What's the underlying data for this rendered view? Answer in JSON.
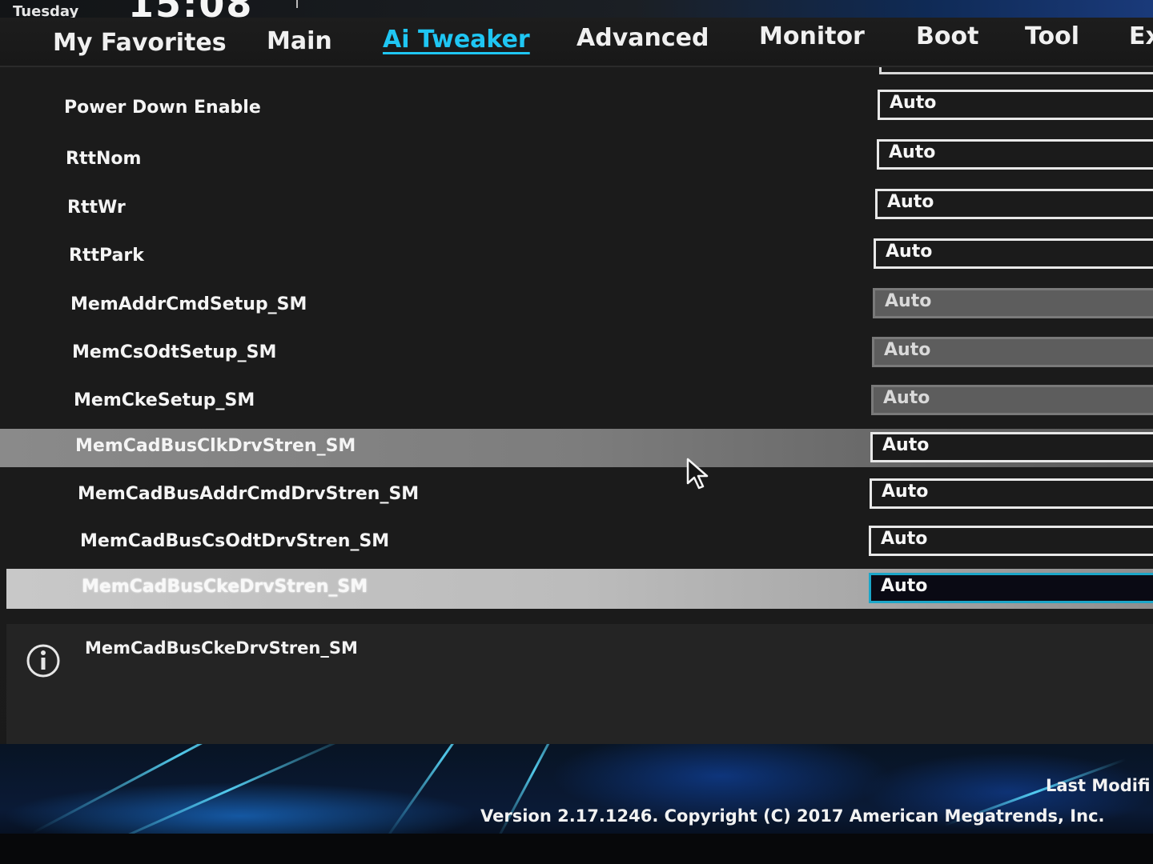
{
  "header": {
    "day": "Tuesday",
    "time": "15:08"
  },
  "nav": {
    "tabs": [
      {
        "label": "My Favorites",
        "active": false
      },
      {
        "label": "Main",
        "active": false
      },
      {
        "label": "Ai Tweaker",
        "active": true
      },
      {
        "label": "Advanced",
        "active": false
      },
      {
        "label": "Monitor",
        "active": false
      },
      {
        "label": "Boot",
        "active": false
      },
      {
        "label": "Tool",
        "active": false
      },
      {
        "label": "Ex",
        "active": false
      }
    ]
  },
  "settings": [
    {
      "label": "Power Down Enable",
      "value": "Auto",
      "state": "normal"
    },
    {
      "label": "RttNom",
      "value": "Auto",
      "state": "normal"
    },
    {
      "label": "RttWr",
      "value": "Auto",
      "state": "normal"
    },
    {
      "label": "RttPark",
      "value": "Auto",
      "state": "normal"
    },
    {
      "label": "MemAddrCmdSetup_SM",
      "value": "Auto",
      "state": "disabled"
    },
    {
      "label": "MemCsOdtSetup_SM",
      "value": "Auto",
      "state": "disabled"
    },
    {
      "label": "MemCkeSetup_SM",
      "value": "Auto",
      "state": "disabled"
    },
    {
      "label": "MemCadBusClkDrvStren_SM",
      "value": "Auto",
      "state": "hover"
    },
    {
      "label": "MemCadBusAddrCmdDrvStren_SM",
      "value": "Auto",
      "state": "normal"
    },
    {
      "label": "MemCadBusCsOdtDrvStren_SM",
      "value": "Auto",
      "state": "normal"
    },
    {
      "label": "MemCadBusCkeDrvStren_SM",
      "value": "Auto",
      "state": "selected"
    }
  ],
  "help": {
    "text": "MemCadBusCkeDrvStren_SM"
  },
  "footer": {
    "last_modified": "Last Modifi",
    "version": "Version 2.17.1246. Copyright (C) 2017 American Megatrends, Inc."
  },
  "colors": {
    "accent": "#1fc6f3",
    "panel_bg": "#1b1b1b",
    "selected_border": "#1ba6c9"
  }
}
